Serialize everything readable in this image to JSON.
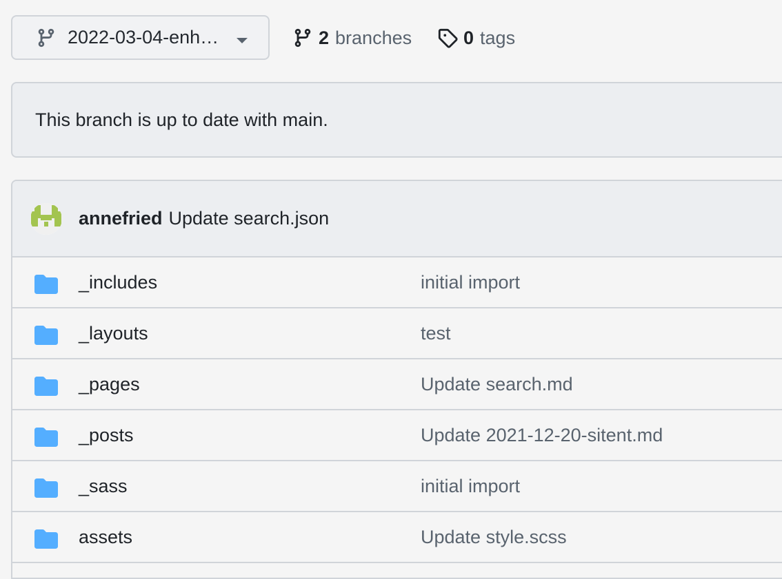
{
  "branch_selector": {
    "current_branch": "2022-03-04-enh…",
    "icon": "git-branch-icon",
    "caret_icon": "caret-down-icon"
  },
  "branches": {
    "count": "2",
    "label": "branches",
    "icon": "git-branch-icon"
  },
  "tags": {
    "count": "0",
    "label": "tags",
    "icon": "tag-icon"
  },
  "status": {
    "text": "This branch is up to date with main."
  },
  "latest_commit": {
    "author": "annefried",
    "message": "Update search.json",
    "avatar_color": "#a3c450"
  },
  "files": [
    {
      "name": "_includes",
      "type": "folder",
      "message": "initial import"
    },
    {
      "name": "_layouts",
      "type": "folder",
      "message": "test"
    },
    {
      "name": "_pages",
      "type": "folder",
      "message": "Update search.md"
    },
    {
      "name": "_posts",
      "type": "folder",
      "message": "Update 2021-12-20-sitent.md"
    },
    {
      "name": "_sass",
      "type": "folder",
      "message": "initial import"
    },
    {
      "name": "assets",
      "type": "folder",
      "message": "Update style.scss"
    }
  ],
  "colors": {
    "folder": "#54aeff",
    "muted_text": "#59636e",
    "border": "#d0d4d9"
  }
}
